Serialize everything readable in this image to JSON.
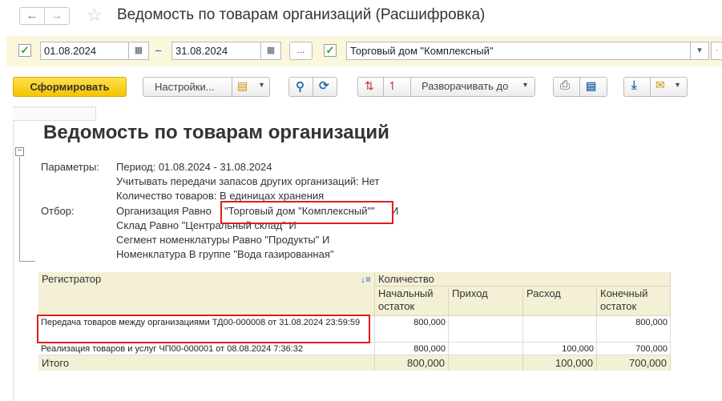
{
  "window": {
    "title": "Ведомость по товарам организаций (Расшифровка)",
    "back_icon": "arrow-left-icon",
    "forward_icon": "arrow-right-icon",
    "favorite_icon": "star-icon"
  },
  "params": {
    "date_from": "01.08.2024",
    "date_to": "31.08.2024",
    "dash": "–",
    "select_period_label": "...",
    "organization": "Торговый дом \"Комплексный\"",
    "accent_check": "#2e9a2e"
  },
  "toolbar": {
    "generate_label": "Сформировать",
    "settings_label": "Настройки...",
    "expand_label": "Разворачивать до"
  },
  "report": {
    "title": "Ведомость по товарам организаций",
    "params_label": "Параметры:",
    "period": "Период: 01.08.2024 - 31.08.2024",
    "transfer": "Учитывать передачи запасов других организаций: Нет",
    "quantity": "Количество товаров: В единицах хранения",
    "filter_label": "Отбор:",
    "filter_org_prefix": "Организация Равно",
    "filter_org_value": "\"Торговый дом \"Комплексный\"\"",
    "filter_org_suffix": "И",
    "filter_warehouse": "Склад Равно \"Центральный склад\" И",
    "filter_segment": "Сегмент номенклатуры Равно \"Продукты\" И",
    "filter_nomenclature": "Номенклатура В группе \"Вода газированная\""
  },
  "table": {
    "col_registrar": "Регистратор",
    "col_quantity": "Количество",
    "col_opening": "Начальный остаток",
    "col_in": "Приход",
    "col_out": "Расход",
    "col_closing": "Конечный остаток",
    "rows": [
      {
        "registrar": "Передача товаров между организациями ТД00-000008 от 31.08.2024 23:59:59",
        "opening": "800,000",
        "in": "",
        "out": "",
        "closing": "800,000"
      },
      {
        "registrar": "Реализация товаров и услуг ЧП00-000001 от 08.08.2024 7:36:32",
        "opening": "800,000",
        "in": "",
        "out": "100,000",
        "closing": "700,000"
      }
    ],
    "total": {
      "label": "Итого",
      "opening": "800,000",
      "in": "",
      "out": "100,000",
      "closing": "700,000"
    }
  },
  "highlight_color": "#e01e1e"
}
